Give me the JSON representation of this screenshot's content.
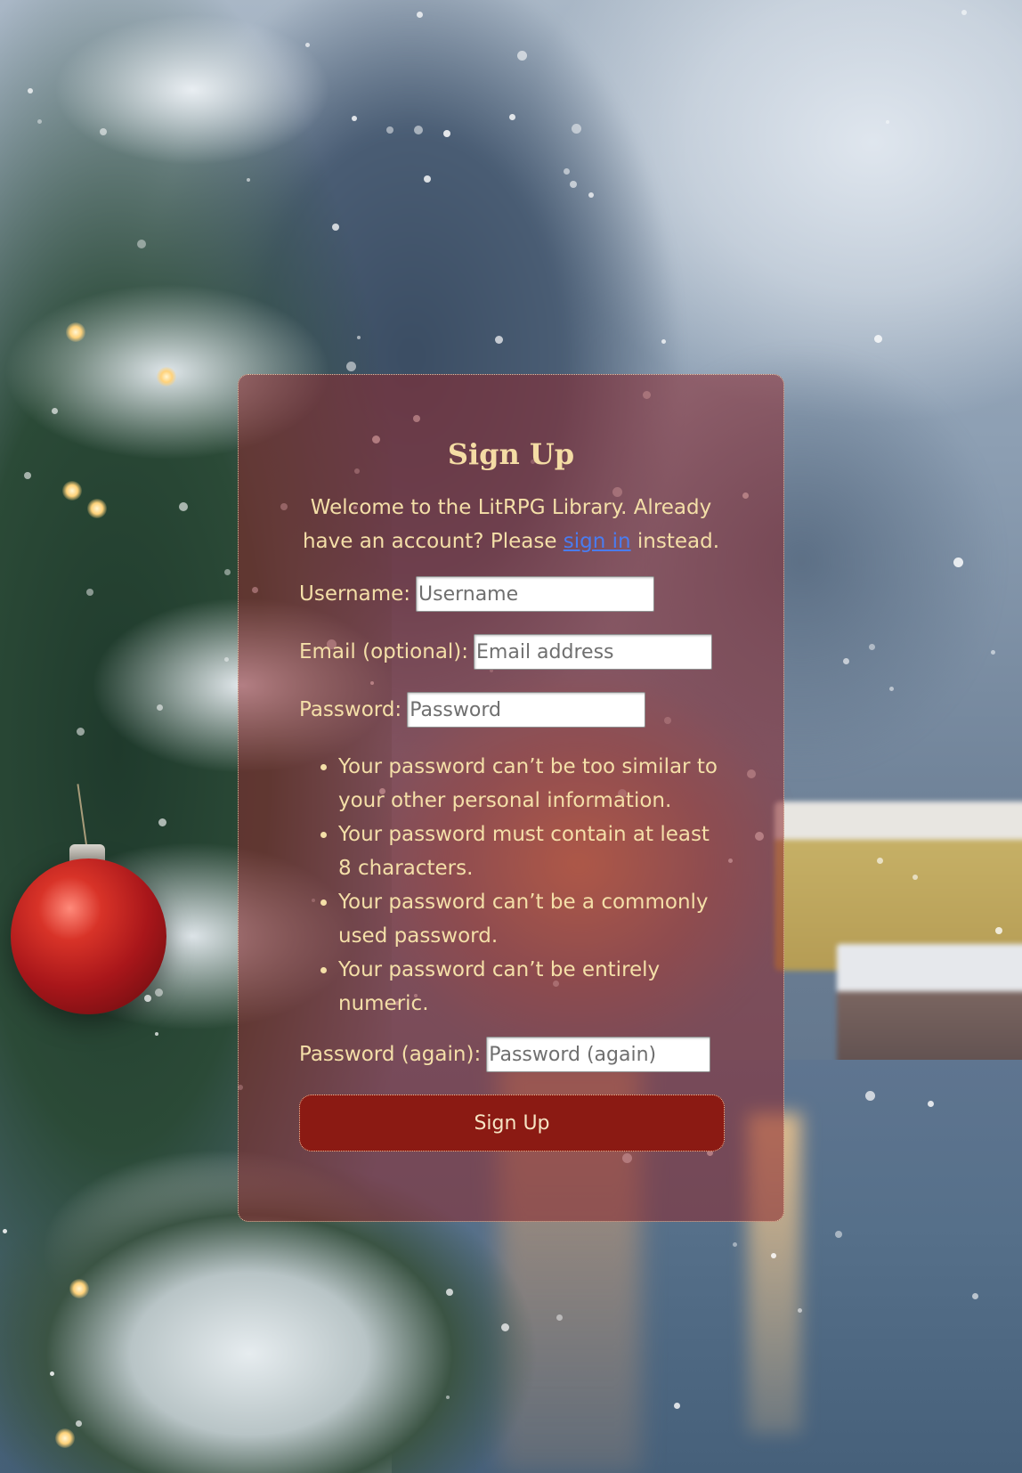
{
  "form": {
    "title": "Sign Up",
    "intro_before": "Welcome to the LitRPG Library. Already have an account? Please ",
    "signin_link": "sign in",
    "intro_after": " instead.",
    "username": {
      "label": "Username:",
      "placeholder": "Username"
    },
    "email": {
      "label": "Email (optional):",
      "placeholder": "Email address"
    },
    "password": {
      "label": "Password:",
      "placeholder": "Password"
    },
    "password_rules": [
      "Your password can’t be too similar to your other personal information.",
      "Your password must contain at least 8 characters.",
      "Your password can’t be a commonly used password.",
      "Your password can’t be entirely numeric."
    ],
    "password_again": {
      "label": "Password (again):",
      "placeholder": "Password (again)"
    },
    "submit_label": "Sign Up"
  },
  "colors": {
    "card_background": "#8c282d",
    "heading_text": "#f4dca4",
    "link": "#4a7cf0",
    "button": "#8b1a13"
  },
  "background": {
    "icons": [
      "christmas-tree-icon",
      "ornament-icon",
      "snowflake-icon"
    ]
  }
}
